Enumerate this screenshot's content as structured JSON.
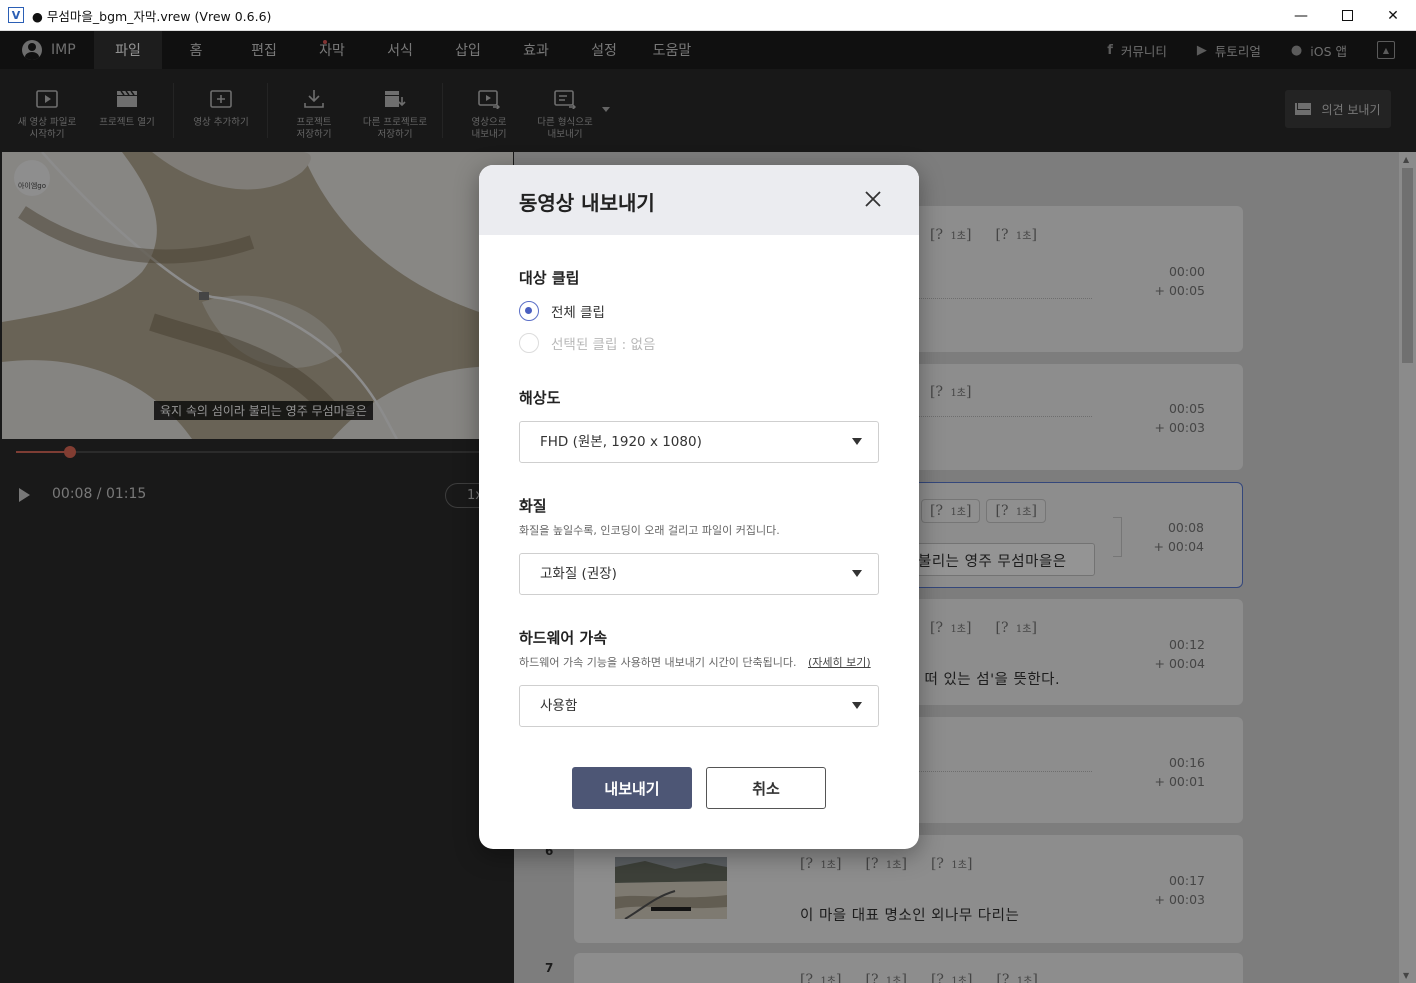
{
  "window": {
    "title": "● 무섬마을_bgm_자막.vrew (Vrew 0.6.6)"
  },
  "menubar": {
    "user": "IMP",
    "tabs": [
      "파일",
      "홈",
      "편집",
      "자막",
      "서식",
      "삽입",
      "효과",
      "설정",
      "도움말"
    ],
    "active_tab": "파일",
    "links": [
      "커뮤니티",
      "튜토리얼",
      "iOS 앱"
    ]
  },
  "toolbar": {
    "items": [
      "새 영상 파일로\n시작하기",
      "프로젝트 열기",
      "영상 추가하기",
      "프로젝트\n저장하기",
      "다른 프로젝트로\n저장하기",
      "영상으로\n내보내기",
      "다른 형식으로\n내보내기"
    ],
    "feedback": "의견 보내기"
  },
  "player": {
    "subtitle": "육지 속의 섬이라 불리는 영주 무섬마을은",
    "logo": "아이엠go",
    "timecode": "00:08 / 01:15",
    "speed": "1x",
    "progress": 0.107
  },
  "clips": [
    {
      "words": [
        "?",
        "?"
      ],
      "start": "00:00",
      "dur": "+ 00:05",
      "text": ""
    },
    {
      "words": [
        "?"
      ],
      "start": "00:05",
      "dur": "+ 00:03",
      "text": ""
    },
    {
      "words": [
        "?",
        "?"
      ],
      "start": "00:08",
      "dur": "+ 00:04",
      "text": "불리는 영주 무섬마을은"
    },
    {
      "words": [
        "?",
        "?"
      ],
      "start": "00:12",
      "dur": "+ 00:04",
      "text": "| 떠 있는 섬'을 뜻한다."
    },
    {
      "words": [],
      "start": "00:16",
      "dur": "+ 00:01",
      "text": ""
    },
    {
      "index": "6",
      "words": [
        "?",
        "?",
        "?"
      ],
      "start": "00:17",
      "dur": "+ 00:03",
      "text": "이 마을 대표 명소인 외나무 다리는"
    },
    {
      "index": "7",
      "words": [
        "?",
        "?",
        "?",
        "?"
      ],
      "start": "",
      "dur": "",
      "text": ""
    }
  ],
  "word_unit": "1초",
  "dialog": {
    "title": "동영상 내보내기",
    "target": {
      "title": "대상 클립",
      "options": [
        "전체 클립",
        "선택된 클립 : 없음"
      ],
      "selected": 0
    },
    "resolution": {
      "title": "해상도",
      "value": "FHD (원본, 1920 x 1080)"
    },
    "quality": {
      "title": "화질",
      "desc": "화질을 높일수록, 인코딩이 오래 걸리고 파일이 커집니다.",
      "value": "고화질 (권장)"
    },
    "hw": {
      "title": "하드웨어 가속",
      "desc": "하드웨어 가속 기능을 사용하면 내보내기 시간이 단축됩니다.",
      "more": "(자세히 보기)",
      "value": "사용함"
    },
    "export_button": "내보내기",
    "cancel_button": "취소"
  }
}
